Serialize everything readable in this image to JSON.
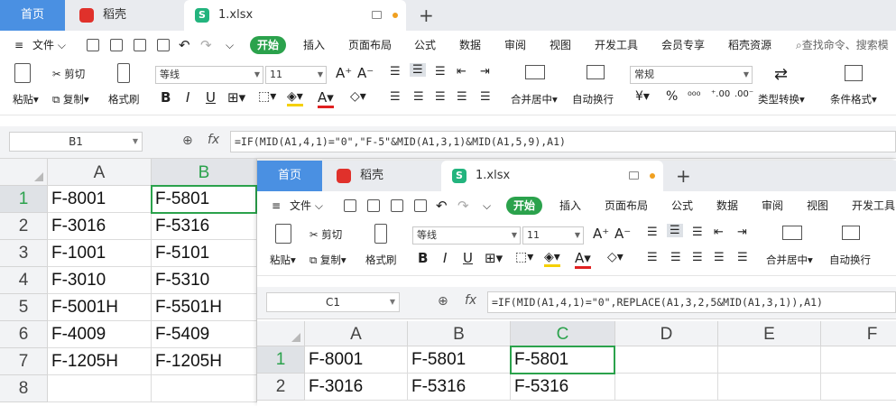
{
  "window1": {
    "tabs": {
      "home": "首页",
      "daoke": "稻壳",
      "doc": "1.xlsx"
    },
    "menu": [
      "文件",
      "开始",
      "插入",
      "页面布局",
      "公式",
      "数据",
      "审阅",
      "视图",
      "开发工具",
      "会员专享",
      "稻壳资源"
    ],
    "search_placeholder": "查找命令、搜索模",
    "ribbon": {
      "paste": "粘贴",
      "cut": "剪切",
      "copy": "复制",
      "format_painter": "格式刷",
      "font": "等线",
      "font_size": "11",
      "merge_center": "合并居中",
      "wrap_text": "自动换行",
      "number_format": "常规",
      "type_convert": "类型转换",
      "cond_format": "条件格式"
    },
    "name_box": "B1",
    "formula": "=IF(MID(A1,4,1)=\"0\",\"F-5\"&MID(A1,3,1)&MID(A1,5,9),A1)",
    "columns": [
      "A",
      "B"
    ],
    "rows": [
      {
        "n": "1",
        "a": "F-8001",
        "b": "F-5801"
      },
      {
        "n": "2",
        "a": "F-3016",
        "b": "F-5316"
      },
      {
        "n": "3",
        "a": "F-1001",
        "b": "F-5101"
      },
      {
        "n": "4",
        "a": "F-3010",
        "b": "F-5310"
      },
      {
        "n": "5",
        "a": "F-5001H",
        "b": "F-5501H"
      },
      {
        "n": "6",
        "a": "F-4009",
        "b": "F-5409"
      },
      {
        "n": "7",
        "a": "F-1205H",
        "b": "F-1205H"
      },
      {
        "n": "8",
        "a": "",
        "b": ""
      }
    ]
  },
  "window2": {
    "tabs": {
      "home": "首页",
      "daoke": "稻壳",
      "doc": "1.xlsx"
    },
    "menu": [
      "文件",
      "开始",
      "插入",
      "页面布局",
      "公式",
      "数据",
      "审阅",
      "视图",
      "开发工具"
    ],
    "ribbon": {
      "paste": "粘贴",
      "cut": "剪切",
      "copy": "复制",
      "format_painter": "格式刷",
      "font": "等线",
      "font_size": "11",
      "merge_center": "合并居中",
      "wrap_text": "自动换行"
    },
    "name_box": "C1",
    "formula": "=IF(MID(A1,4,1)=\"0\",REPLACE(A1,3,2,5&MID(A1,3,1)),A1)",
    "columns": [
      "A",
      "B",
      "C",
      "D",
      "E",
      "F"
    ],
    "rows": [
      {
        "n": "1",
        "a": "F-8001",
        "b": "F-5801",
        "c": "F-5801"
      },
      {
        "n": "2",
        "a": "F-3016",
        "b": "F-5316",
        "c": "F-5316"
      }
    ]
  },
  "colors": {
    "accent": "#2ba24c",
    "home_tab": "#4a90e2",
    "daoke_logo": "#e0312b",
    "sheet_logo": "#23b47e"
  }
}
